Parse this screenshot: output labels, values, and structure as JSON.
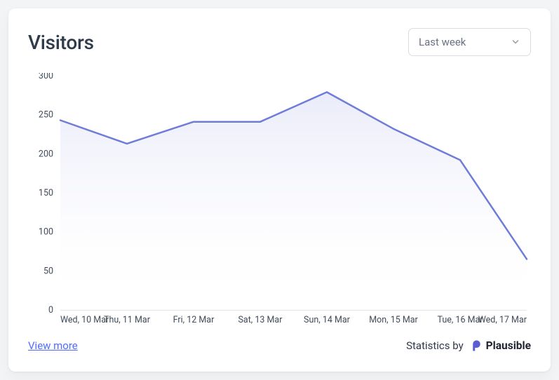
{
  "title": "Visitors",
  "range_selector": {
    "label": "Last week"
  },
  "view_more": "View more",
  "attribution": {
    "text": "Statistics by",
    "brand": "Plausible"
  },
  "colors": {
    "line": "#6f7dd8",
    "area_top": "#e6e8f8",
    "area_bottom": "#ffffff"
  },
  "chart_data": {
    "type": "line",
    "title": "Visitors",
    "xlabel": "",
    "ylabel": "",
    "ylim": [
      0,
      300
    ],
    "yticks": [
      0,
      50,
      100,
      150,
      200,
      250,
      300
    ],
    "categories": [
      "Wed, 10 Mar",
      "Thu, 11 Mar",
      "Fri, 12 Mar",
      "Sat, 13 Mar",
      "Sun, 14 Mar",
      "Mon, 15 Mar",
      "Tue, 16 Mar",
      "Wed, 17 Mar"
    ],
    "series": [
      {
        "name": "Visitors",
        "values": [
          243,
          213,
          241,
          241,
          279,
          232,
          192,
          65
        ]
      }
    ],
    "grid": false,
    "legend": false
  }
}
